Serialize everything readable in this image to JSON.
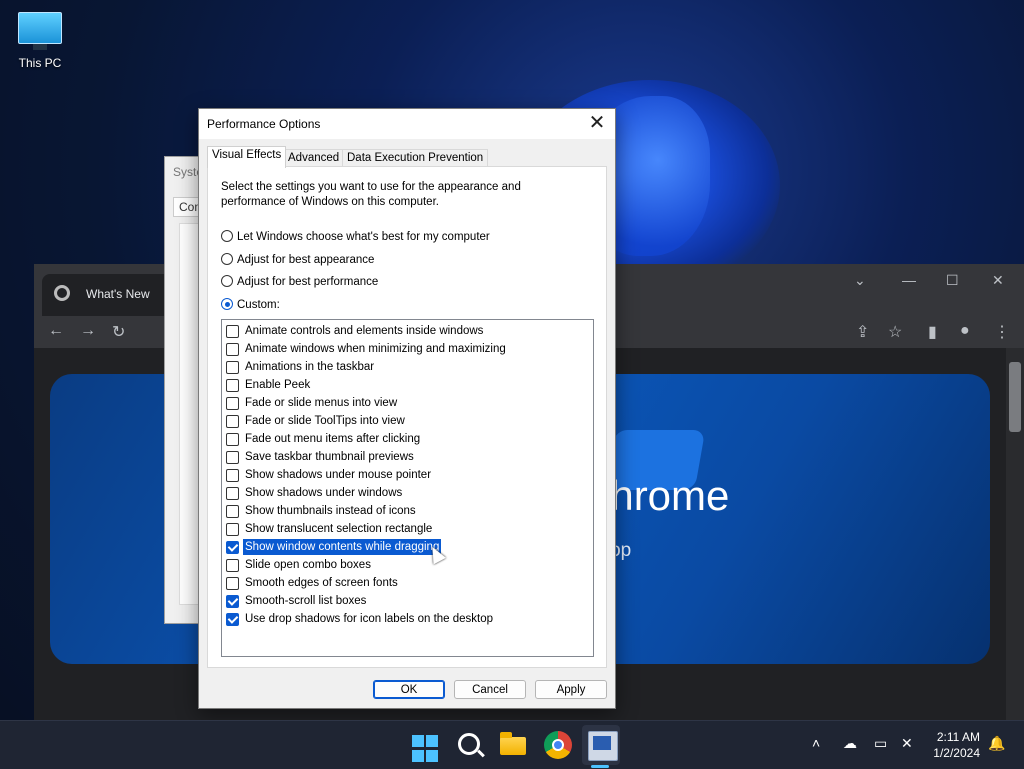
{
  "desktop": {
    "icon_label": "This PC"
  },
  "sysprop": {
    "title": "Syste",
    "tab": "Com"
  },
  "chrome": {
    "tab_title": "What's New",
    "banner_title": "Chrome",
    "banner_sub": "shop"
  },
  "dialog": {
    "title": "Performance Options",
    "close_glyph": "✕",
    "tabs": [
      "Visual Effects",
      "Advanced",
      "Data Execution Prevention"
    ],
    "description": "Select the settings you want to use for the appearance and performance of Windows on this computer.",
    "radios": [
      {
        "label": "Let Windows choose what's best for my computer",
        "checked": false
      },
      {
        "label": "Adjust for best appearance",
        "checked": false
      },
      {
        "label": "Adjust for best performance",
        "checked": false
      },
      {
        "label": "Custom:",
        "checked": true
      }
    ],
    "effects": [
      {
        "label": "Animate controls and elements inside windows",
        "checked": false
      },
      {
        "label": "Animate windows when minimizing and maximizing",
        "checked": false
      },
      {
        "label": "Animations in the taskbar",
        "checked": false
      },
      {
        "label": "Enable Peek",
        "checked": false
      },
      {
        "label": "Fade or slide menus into view",
        "checked": false
      },
      {
        "label": "Fade or slide ToolTips into view",
        "checked": false
      },
      {
        "label": "Fade out menu items after clicking",
        "checked": false
      },
      {
        "label": "Save taskbar thumbnail previews",
        "checked": false
      },
      {
        "label": "Show shadows under mouse pointer",
        "checked": false
      },
      {
        "label": "Show shadows under windows",
        "checked": false
      },
      {
        "label": "Show thumbnails instead of icons",
        "checked": false
      },
      {
        "label": "Show translucent selection rectangle",
        "checked": false
      },
      {
        "label": "Show window contents while dragging",
        "checked": true,
        "selected": true
      },
      {
        "label": "Slide open combo boxes",
        "checked": false
      },
      {
        "label": "Smooth edges of screen fonts",
        "checked": false
      },
      {
        "label": "Smooth-scroll list boxes",
        "checked": true
      },
      {
        "label": "Use drop shadows for icon labels on the desktop",
        "checked": true
      }
    ],
    "buttons": {
      "ok": "OK",
      "cancel": "Cancel",
      "apply": "Apply"
    }
  },
  "taskbar": {
    "time": "2:11 AM",
    "date": "1/2/2024",
    "colors": {
      "accent": "#4cc2ff",
      "selection": "#0a5ad1"
    }
  }
}
